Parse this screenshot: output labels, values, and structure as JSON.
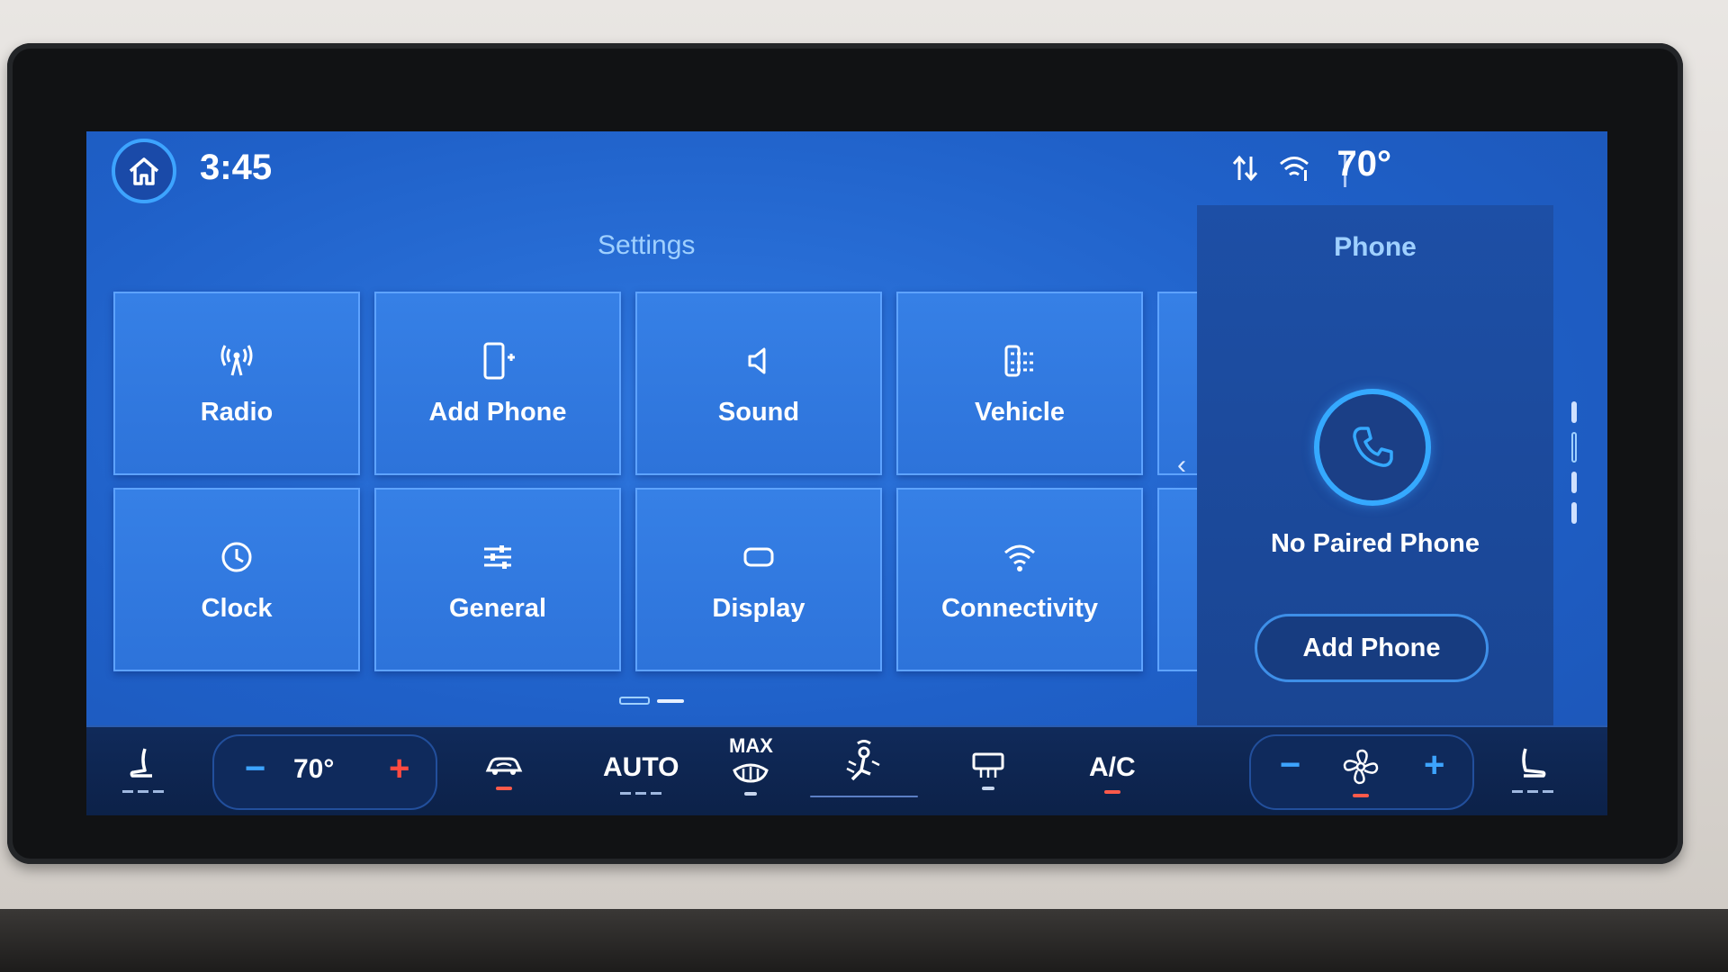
{
  "status_bar": {
    "time": "3:45",
    "outside_temp": "70°",
    "icons": [
      "home-icon",
      "signal-arrows-icon",
      "wifi-hotspot-icon"
    ]
  },
  "settings": {
    "title": "Settings",
    "tiles": [
      {
        "label": "Radio",
        "icon": "antenna-icon"
      },
      {
        "label": "Add Phone",
        "icon": "add-phone-icon"
      },
      {
        "label": "Sound",
        "icon": "speaker-icon"
      },
      {
        "label": "Vehicle",
        "icon": "vehicle-icon"
      },
      {
        "label": "Clock",
        "icon": "clock-icon"
      },
      {
        "label": "General",
        "icon": "sliders-icon"
      },
      {
        "label": "Display",
        "icon": "display-icon"
      },
      {
        "label": "Connectivity",
        "icon": "wifi-icon"
      }
    ],
    "page_count": 2,
    "current_page": 1
  },
  "phone": {
    "title": "Phone",
    "status": "No Paired Phone",
    "add_label": "Add Phone"
  },
  "climate": {
    "driver_temp": "70°",
    "auto_label": "AUTO",
    "max_label": "MAX",
    "ac_label": "A/C",
    "minus": "−",
    "plus": "+"
  },
  "colors": {
    "screen_blue": "#1f60c8",
    "accent_light_blue": "#9fd0ff",
    "ring_blue": "#35a9ff",
    "indicator_red": "#ff5a4a"
  }
}
